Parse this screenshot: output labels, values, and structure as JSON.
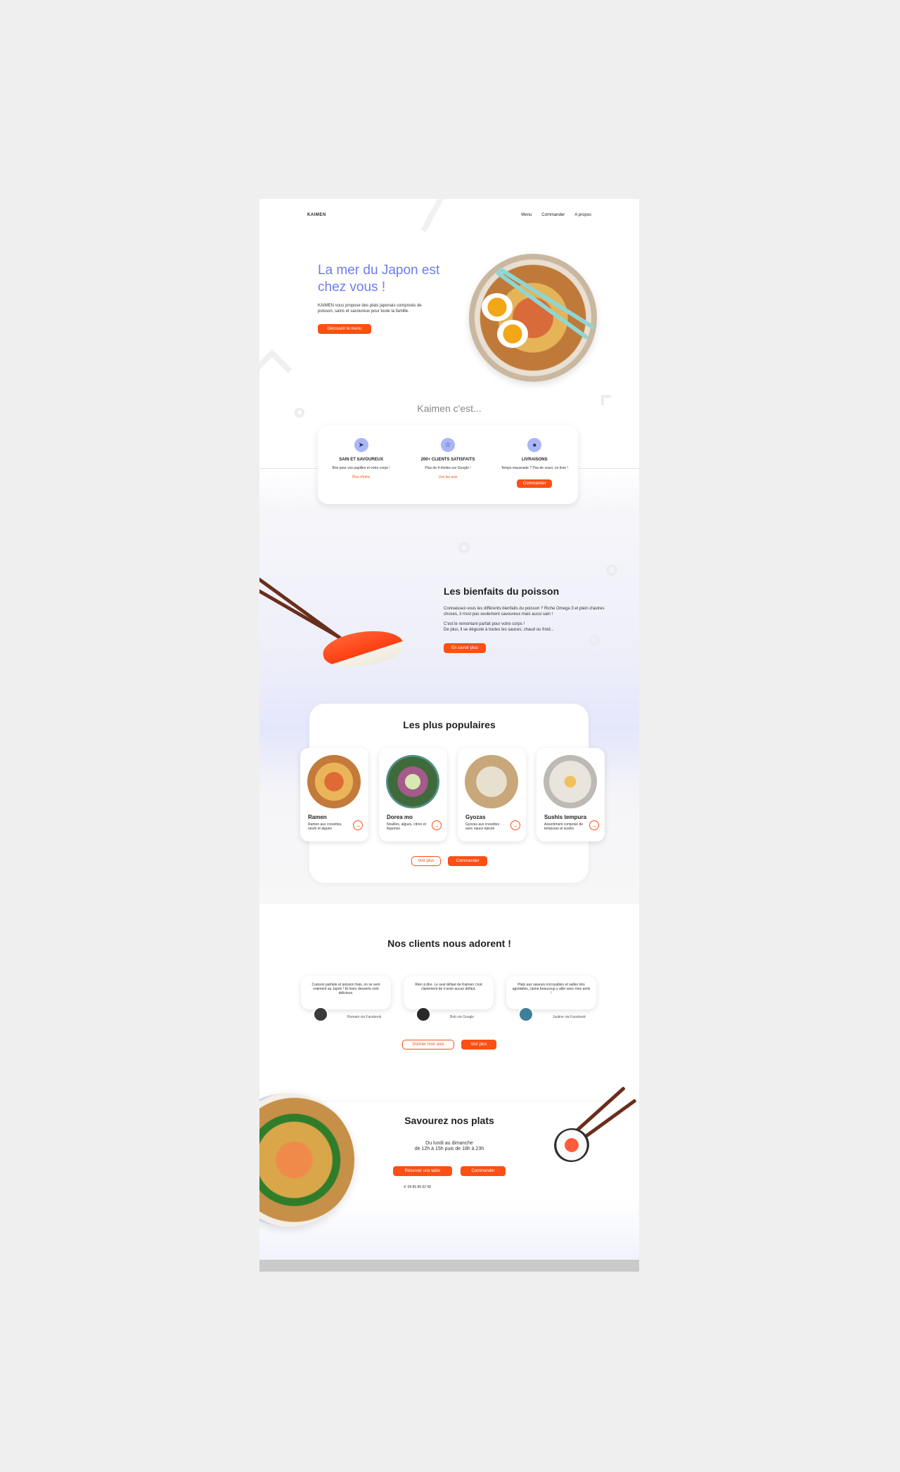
{
  "nav": {
    "logo": "KAIMEN",
    "links": [
      "Menu",
      "Commander",
      "A propos"
    ]
  },
  "hero": {
    "title": "La mer du Japon est chez vous !",
    "text": "KAIMEN vous propose des plats japonais composés de poisson, sains et savoureux pour toute la famille.",
    "button": "Découvrir le menu"
  },
  "kaimen": {
    "title": "Kaimen c'est...",
    "features": [
      {
        "icon": "rocket-icon",
        "title": "SAIN ET SAVOUREUX",
        "text": "Bon pour vos papilles et votre corps !",
        "link": "Plus d'infos"
      },
      {
        "icon": "star-icon",
        "title": "200+ CLIENTS SATISFAITS",
        "text": "Plus de 4 étoiles sur Google !",
        "link": "Voir les avis"
      },
      {
        "icon": "scooter-icon",
        "title": "LIVRAISONS",
        "text": "Temps maussade ? Pas de souci, on livre !",
        "button": "Commander"
      }
    ]
  },
  "bienfaits": {
    "title": "Les bienfaits du poisson",
    "p1": "Connaissez-vous les différents bienfaits du poisson ? Riche Omega 3 et plein d'autres choses, il n'est pas seulement savoureux mais aussi sain !",
    "p2": "C'est le remontant parfait pour votre corps !",
    "p3": "De plus, il se déguste à toutes les sauces; chaud ou froid...",
    "button": "En savoir plus"
  },
  "populaires": {
    "title": "Les plus populaires",
    "dishes": [
      {
        "name": "Ramen",
        "desc": "Ramen aux crevettes, oeufs et algues"
      },
      {
        "name": "Dorea mo",
        "desc": "Nouilles, algues, citron et légumes"
      },
      {
        "name": "Gyozas",
        "desc": "Gyozas aux crevettes avec sauce épicée"
      },
      {
        "name": "Sushis tempura",
        "desc": "Assortiment composé de tempuras et sushis"
      }
    ],
    "btn_more": "Voir plus",
    "btn_order": "Commander"
  },
  "clients": {
    "title": "Nos clients nous adorent !",
    "reviews": [
      {
        "text": "Cuisson parfaite et poisson frais, on se sent vraiment au Japon ! Et leurs desserts sont délicieux.",
        "author": "Romain via Facebook"
      },
      {
        "text": "Rien à dire. Le seul défaut de Kaimen c'est clairement de n'avoir aucun défaut.",
        "author": "Bob via Google"
      },
      {
        "text": "Plats aux saveurs incroyables et salles très agréables, j'aime beaucoup y aller avec mes amis !",
        "author": "Justine via Facebook"
      }
    ],
    "btn_review": "Donner mon avis",
    "btn_more": "Voir plus"
  },
  "savourez": {
    "title": "Savourez nos plats",
    "hours1": "Du lundi au dimanche",
    "hours2": "de 12h à 15h puis de 18h à 23h",
    "btn_table": "Réserver une table",
    "btn_order": "Commander",
    "phone": "04 85 89 62 58"
  },
  "colors": {
    "accent": "#fb4f14",
    "title_blue": "#6d7cf0",
    "icon_bg": "#aab6f6"
  }
}
